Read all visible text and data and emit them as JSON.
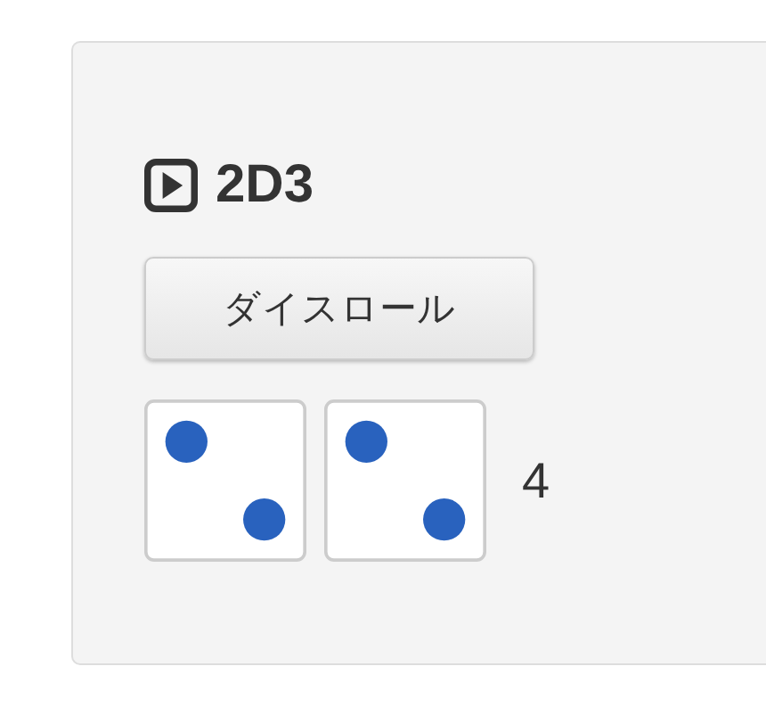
{
  "title": "2D3",
  "button": "ダイスロール",
  "dice": [
    {
      "kind": "two"
    },
    {
      "kind": "two"
    }
  ],
  "total": "4"
}
